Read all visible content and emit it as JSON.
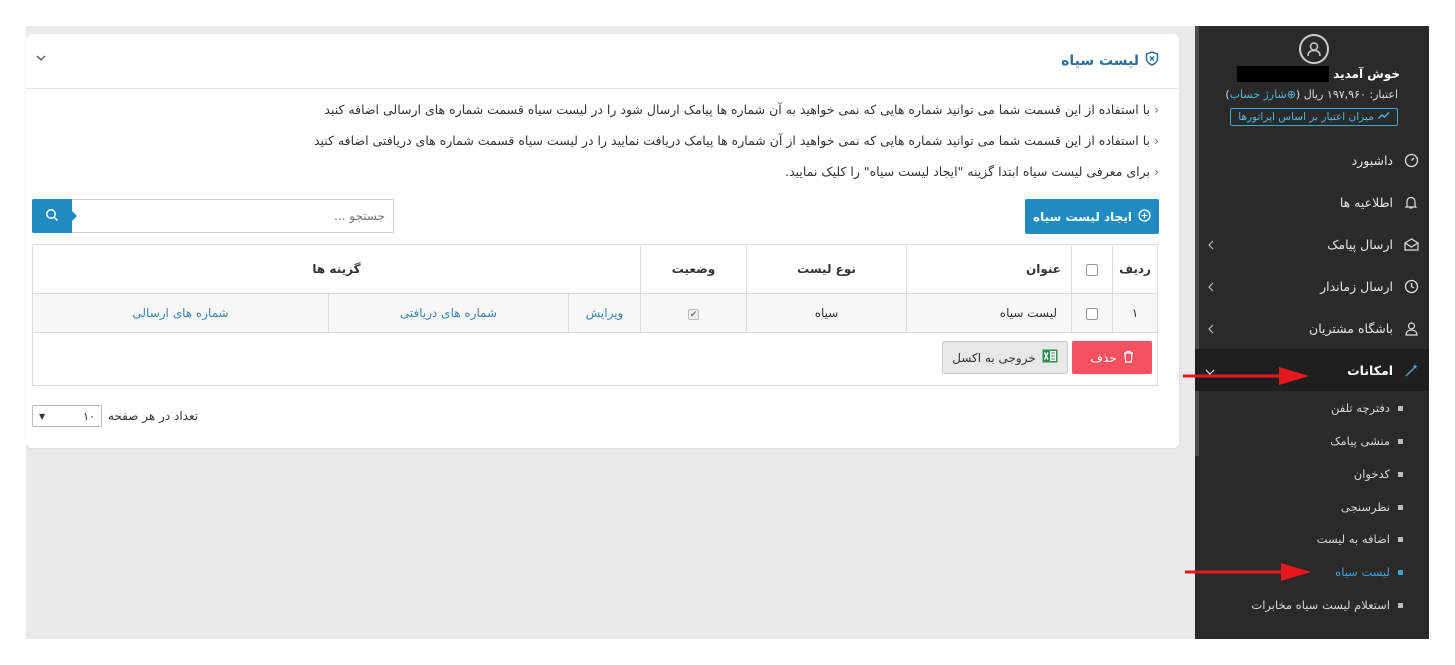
{
  "card": {
    "title": "لیست سیاه",
    "info_lines": [
      "با استفاده از این قسمت شما می توانید شماره هایی که نمی خواهید به آن شماره ها پیامک ارسال شود را در لیست سیاه قسمت شماره های ارسالی اضافه کنید",
      "با استفاده از این قسمت شما می توانید شماره هایی که نمی خواهید از آن شماره ها پیامک دریافت نمایید را در لیست سیاه قسمت شماره های دریافتی اضافه کنید",
      "برای معرفی لیست سیاه ابتدا گزینه \"ایجاد لیست سیاه\" را کلیک نمایید."
    ],
    "create_button": "ایجاد لیست سیاه",
    "search_placeholder": "جستجو ..."
  },
  "table": {
    "headers": {
      "row": "ردیف",
      "title": "عنوان",
      "list_type": "نوع لیست",
      "status": "وضعیت",
      "options": "گزینه ها"
    },
    "rows": [
      {
        "index": "۱",
        "title": "لیست سیاه",
        "list_type": "سیاه",
        "status_checked": true,
        "edit": "ویرایش",
        "received": "شماره های دریافتی",
        "sent": "شماره های ارسالی"
      }
    ],
    "delete_button": "حذف",
    "excel_button": "خروجی به اکسل"
  },
  "pagination": {
    "label": "تعداد در هر صفحه",
    "value": "۱۰"
  },
  "sidebar": {
    "welcome": "خوش آمدید",
    "credit_label": "اعتبار: ۱۹۷,۹۶۰ ریال (",
    "charge": "شارژ حساب",
    "credit_close": ")",
    "operator_credit": "میزان اعتبار بر اساس اپراتورها",
    "menu": [
      {
        "label": "داشبورد",
        "icon": "dashboard-icon",
        "has_arrow": false
      },
      {
        "label": "اطلاعیه ها",
        "icon": "bell-icon",
        "has_arrow": false
      },
      {
        "label": "ارسال پیامک",
        "icon": "envelope-icon",
        "has_arrow": true
      },
      {
        "label": "ارسال زماندار",
        "icon": "clock-icon",
        "has_arrow": true
      },
      {
        "label": "باشگاه مشتریان",
        "icon": "users-icon",
        "has_arrow": true
      },
      {
        "label": "امکانات",
        "icon": "magic-wand-icon",
        "has_arrow": true,
        "active": true
      }
    ],
    "submenu": [
      "دفترچه تلفن",
      "منشی پیامک",
      "کدخوان",
      "نظرسنجی",
      "اضافه به لیست",
      "لیست سیاه",
      "استعلام لیست سیاه مخابرات"
    ],
    "active_submenu": "لیست سیاه"
  },
  "colors": {
    "primary": "#1f8bc0",
    "danger": "#f5515f",
    "sidebar_bg": "#2a2a2a",
    "link": "#3f84b8",
    "annotation_arrow": "#e8171c"
  }
}
